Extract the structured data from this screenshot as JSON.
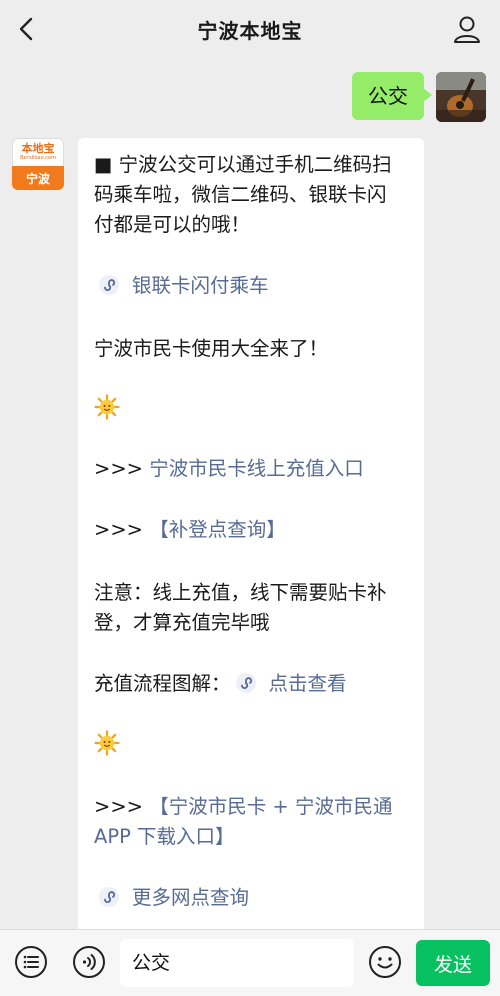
{
  "header": {
    "title": "宁波本地宝"
  },
  "outgoing": {
    "text": "公交"
  },
  "bot": {
    "logo_main": "本地宝",
    "logo_sub": "Bendibao.com",
    "logo_city": "宁波"
  },
  "message": {
    "intro_line1": "■ 宁波公交可以通过手机二维码扫",
    "intro_line2": "码乘车啦，微信二维码、银联卡闪",
    "intro_line3": "付都是可以的哦！",
    "link_unionpay": "银联卡闪付乘车",
    "citizen_card_title": "宁波市民卡使用大全来了！",
    "prefix1": ">>> ",
    "link_recharge": "宁波市民卡线上充值入口",
    "prefix2": ">>> ",
    "link_register": "【补登点查询】",
    "notice_line1": "注意：线上充值，线下需要贴卡补",
    "notice_line2": "登，才算充值完毕哦",
    "flow_label": "充值流程图解：",
    "link_view": "点击查看",
    "prefix3": ">>> ",
    "link_app_line1": "【宁波市民卡 + 宁波市民通",
    "link_app_line2": "APP 下载入口】",
    "link_more": "更多网点查询"
  },
  "input": {
    "value": "公交"
  },
  "send_label": "发送",
  "colors": {
    "bubble_out": "#95ec69",
    "link": "#576b95",
    "send": "#07c160",
    "background": "#ededed"
  }
}
